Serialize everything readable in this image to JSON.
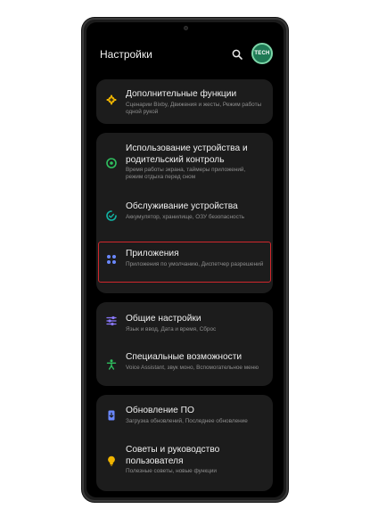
{
  "header": {
    "title": "Настройки",
    "avatar_text": "TECH"
  },
  "colors": {
    "accent_highlight": "#d0272c",
    "icon_yellow": "#f0b400",
    "icon_green": "#2fbf5f",
    "icon_teal": "#12b3a4",
    "icon_blue": "#6a88ff",
    "icon_purple": "#8a78ff"
  },
  "settings": {
    "advanced": {
      "title": "Дополнительные функции",
      "subtitle": "Сценарии Bixby, Движения и жесты, Режим работы одной рукой",
      "icon": "gear-plus-icon"
    },
    "wellbeing": {
      "title": "Использование устройства и родительский контроль",
      "subtitle": "Время работы экрана, таймеры приложений, режим отдыха перед сном",
      "icon": "wellbeing-icon"
    },
    "care": {
      "title": "Обслуживание устройства",
      "subtitle": "Аккумулятор, хранилище, ОЗУ безопасность",
      "icon": "device-care-icon"
    },
    "apps": {
      "title": "Приложения",
      "subtitle": "Приложения по умолчанию, Диспетчер разрешений",
      "icon": "apps-grid-icon",
      "highlighted": true
    },
    "general": {
      "title": "Общие настройки",
      "subtitle": "Язык и ввод, Дата и время, Сброс",
      "icon": "sliders-icon"
    },
    "accessibility": {
      "title": "Специальные возможности",
      "subtitle": "Voice Assistant, звук моно, Вспомогательное меню",
      "icon": "accessibility-icon"
    },
    "update": {
      "title": "Обновление ПО",
      "subtitle": "Загрузка обновлений, Последнее обновление",
      "icon": "software-update-icon"
    },
    "tips": {
      "title": "Советы и руководство пользователя",
      "subtitle": "Полезные советы, новые функции",
      "icon": "lightbulb-icon"
    }
  }
}
